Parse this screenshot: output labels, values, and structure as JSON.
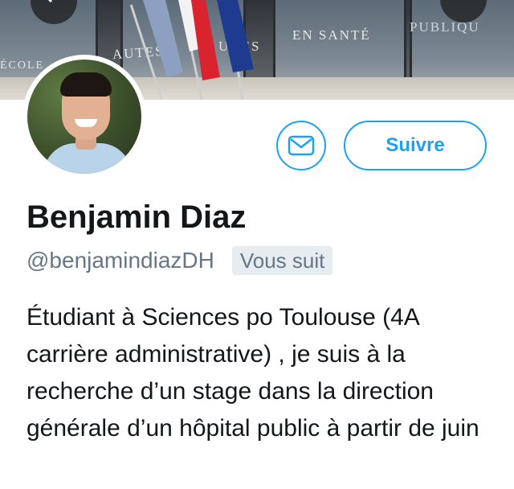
{
  "profile": {
    "name": "Benjamin Diaz",
    "handle": "@benjamindiazDH",
    "follows_you_badge": "Vous suit",
    "bio": "Étudiant à Sciences po Toulouse (4A carrière administrative) , je suis à la recherche d’un stage dans la direction générale d’un hôpital public à partir de juin"
  },
  "actions": {
    "message_icon": "envelope-icon",
    "follow_label": "Suivre"
  },
  "banner": {
    "engraving_left": "ÉCOLE",
    "engraving_mid": "AUTES",
    "engraving_mid2": "UDES",
    "engraving_sante": "EN SANTÉ",
    "engraving_publique": "PUBLIQU"
  },
  "colors": {
    "accent": "#1da1f2",
    "muted_text": "#657786",
    "badge_bg": "#e6ecf0",
    "text": "#14171a"
  }
}
